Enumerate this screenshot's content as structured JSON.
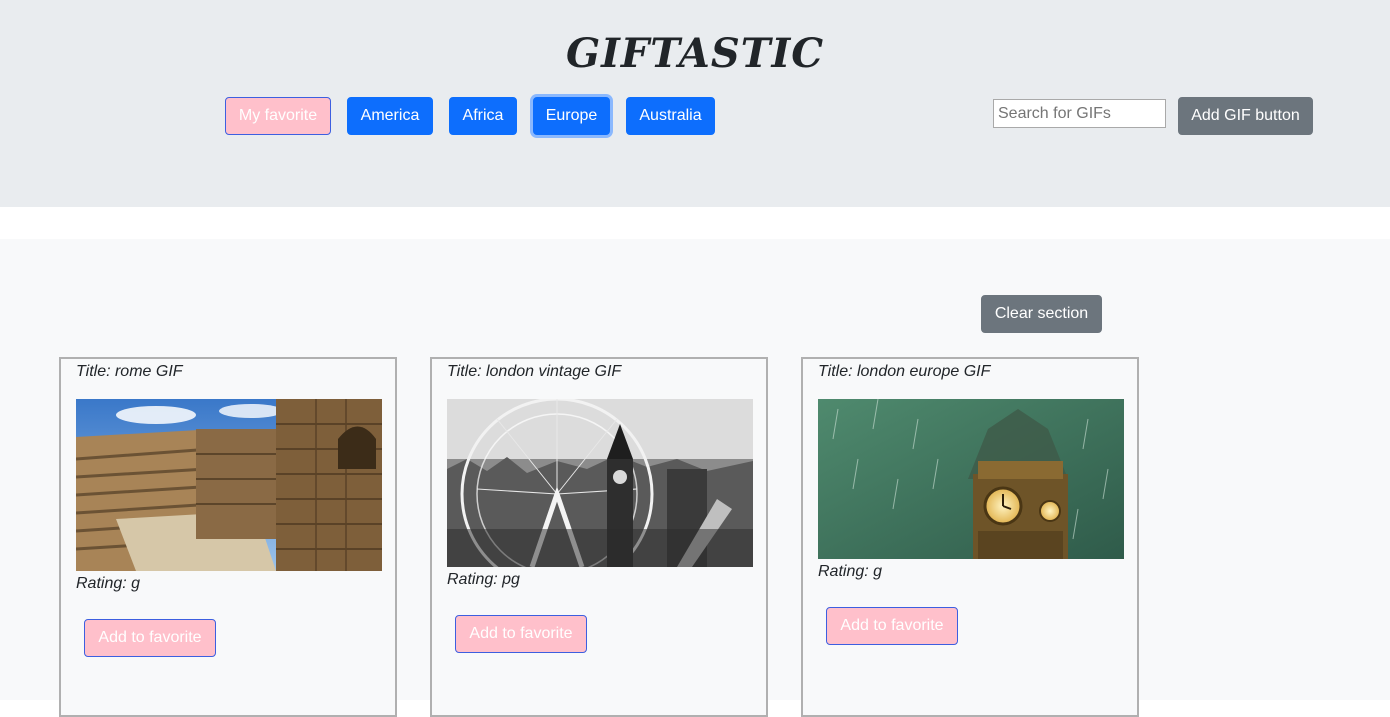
{
  "header": {
    "title": "GIFTASTIC",
    "topics": [
      {
        "label": "My favorite"
      },
      {
        "label": "America"
      },
      {
        "label": "Africa"
      },
      {
        "label": "Europe"
      },
      {
        "label": "Australia"
      }
    ],
    "search_placeholder": "Search for GIFs",
    "add_button_label": "Add GIF button"
  },
  "results": {
    "clear_label": "Clear section",
    "cards": [
      {
        "title": "Title: rome GIF",
        "rating": "Rating: g",
        "button_label": "Add to favorite"
      },
      {
        "title": "Title: london vintage GIF",
        "rating": "Rating: pg",
        "button_label": "Add to favorite"
      },
      {
        "title": "Title: london europe GIF",
        "rating": "Rating: g",
        "button_label": "Add to favorite"
      }
    ]
  },
  "colors": {
    "primary": "#0d6efd",
    "favorite_pink": "#ffc0cb",
    "secondary": "#6c757d",
    "header_bg": "#e9ecef",
    "section_bg": "#f8f9fa"
  }
}
